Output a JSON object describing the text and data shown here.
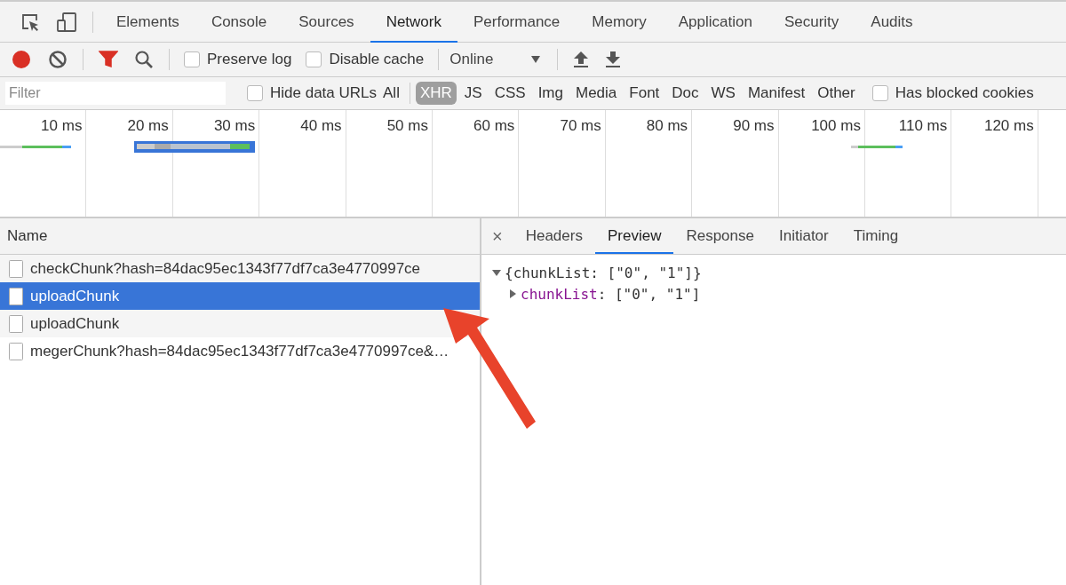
{
  "tabs": [
    {
      "label": "Elements",
      "selected": false
    },
    {
      "label": "Console",
      "selected": false
    },
    {
      "label": "Sources",
      "selected": false
    },
    {
      "label": "Network",
      "selected": true
    },
    {
      "label": "Performance",
      "selected": false
    },
    {
      "label": "Memory",
      "selected": false
    },
    {
      "label": "Application",
      "selected": false
    },
    {
      "label": "Security",
      "selected": false
    },
    {
      "label": "Audits",
      "selected": false
    }
  ],
  "toolbar": {
    "recording": true,
    "filter_on": true,
    "preserve_log": {
      "label": "Preserve log",
      "checked": false
    },
    "disable_cache": {
      "label": "Disable cache",
      "checked": false
    },
    "throttling": "Online"
  },
  "filter_bar": {
    "placeholder": "Filter",
    "hide_data_urls": {
      "label": "Hide data URLs",
      "checked": false
    },
    "types": [
      {
        "label": "All",
        "selected": false
      },
      {
        "label": "XHR",
        "selected": true
      },
      {
        "label": "JS",
        "selected": false
      },
      {
        "label": "CSS",
        "selected": false
      },
      {
        "label": "Img",
        "selected": false
      },
      {
        "label": "Media",
        "selected": false
      },
      {
        "label": "Font",
        "selected": false
      },
      {
        "label": "Doc",
        "selected": false
      },
      {
        "label": "WS",
        "selected": false
      },
      {
        "label": "Manifest",
        "selected": false
      },
      {
        "label": "Other",
        "selected": false
      }
    ],
    "blocked_cookies": {
      "label": "Has blocked cookies",
      "checked": false
    }
  },
  "timeline": {
    "ticks": [
      "10 ms",
      "20 ms",
      "30 ms",
      "40 ms",
      "50 ms",
      "60 ms",
      "70 ms",
      "80 ms",
      "90 ms",
      "100 ms",
      "110 ms",
      "120 ms"
    ]
  },
  "requests": {
    "column": "Name",
    "rows": [
      {
        "name": "checkChunk?hash=84dac95ec1343f77df7ca3e4770997ce",
        "selected": false
      },
      {
        "name": "uploadChunk",
        "selected": true
      },
      {
        "name": "uploadChunk",
        "selected": false
      },
      {
        "name": "megerChunk?hash=84dac95ec1343f77df7ca3e4770997ce&…",
        "selected": false
      }
    ]
  },
  "detail": {
    "close": "×",
    "tabs": [
      {
        "label": "Headers",
        "selected": false
      },
      {
        "label": "Preview",
        "selected": true
      },
      {
        "label": "Response",
        "selected": false
      },
      {
        "label": "Initiator",
        "selected": false
      },
      {
        "label": "Timing",
        "selected": false
      }
    ],
    "preview": {
      "text": "{chunkList: [\"0\", \"1\"]}",
      "expanded": true,
      "children": [
        {
          "key": "chunkList",
          "value": ": [\"0\", \"1\"]",
          "expanded": false
        }
      ]
    }
  }
}
